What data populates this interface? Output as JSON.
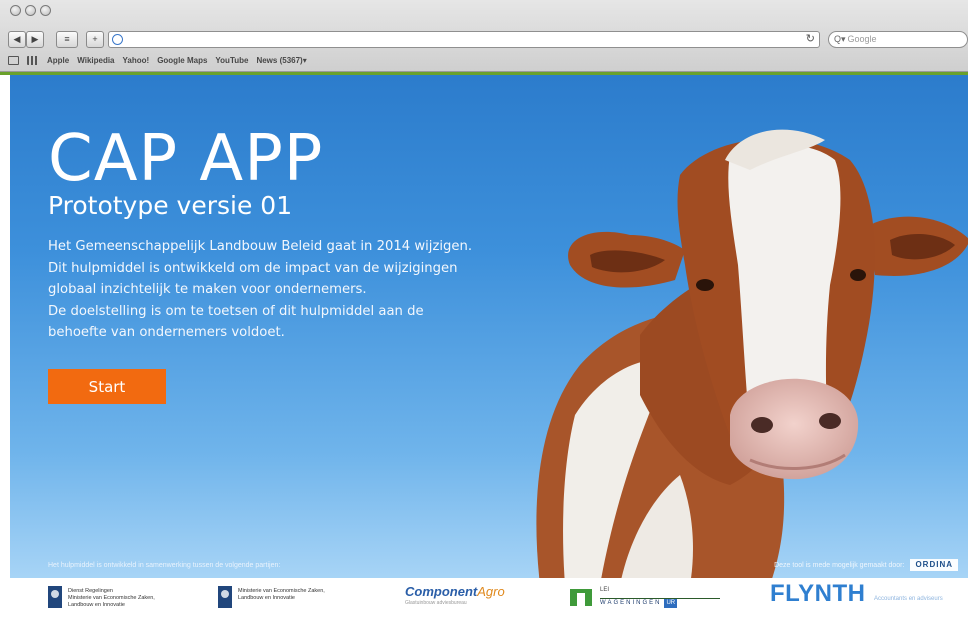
{
  "browser": {
    "bookmarks": [
      "Apple",
      "Wikipedia",
      "Yahoo!",
      "Google Maps",
      "YouTube",
      "News (5367)▾"
    ],
    "search_placeholder": "Google",
    "back_icon": "◀",
    "forward_icon": "▶",
    "bookmark_icon": "≡",
    "add_icon": "+",
    "reload_icon": "↻",
    "search_icon": "Q▾"
  },
  "hero": {
    "title": "CAP APP",
    "subtitle": "Prototype versie 01",
    "body_lines": [
      "Het Gemeenschappelijk Landbouw Beleid gaat in 2014 wijzigen.",
      "Dit hulpmiddel is ontwikkeld om de impact van de wijzigingen",
      "globaal inzichtelijk te maken voor ondernemers.",
      "De doelstelling is om te toetsen of dit hulpmiddel aan de",
      "behoefte van  ondernemers voldoet."
    ],
    "start_label": "Start",
    "start_color": "#f26a10",
    "footnote_left": "Het hulpmiddel is ontwikkeld in samenwerking tussen de volgende partijen:",
    "footnote_right": "Deze tool is mede mogelijk gemaakt door:",
    "ordina_label": "ORDINA"
  },
  "partners": {
    "dr": {
      "line1": "Dienst Regelingen",
      "line2": "Ministerie van Economische Zaken,",
      "line3": "Landbouw en Innovatie"
    },
    "eleni": {
      "line1": "Ministerie van Economische Zaken,",
      "line2": "Landbouw en Innovatie"
    },
    "component": {
      "name": "Component",
      "name_suffix": "Agro",
      "tagline": "Glastuinbouw adviesbureau"
    },
    "lei": {
      "name": "LEI",
      "wur": "WAGENINGEN",
      "ur": "UR"
    },
    "flynth": {
      "name": "FLYNTH",
      "tagline": "Accountants en adviseurs"
    }
  },
  "colors": {
    "accent_green": "#6aa12b",
    "sky_top": "#2c7ccc",
    "flynth_blue": "#2f7fd0"
  }
}
